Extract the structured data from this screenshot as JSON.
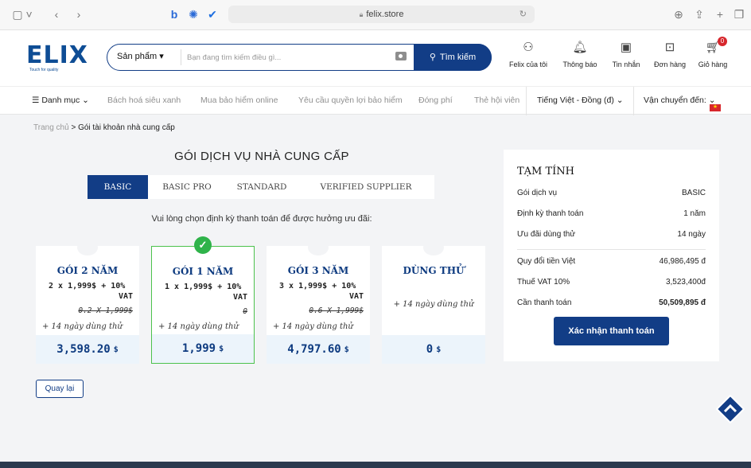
{
  "browser": {
    "url": "felix.store"
  },
  "brand": {
    "name": "ELIX",
    "tagline": "Touch for quality"
  },
  "search": {
    "category": "Sản phẩm ▾",
    "placeholder": "Bạn đang tìm kiếm điều gì...",
    "button": "Tìm kiếm"
  },
  "header_icons": [
    {
      "label": "Felix của tôi"
    },
    {
      "label": "Thông báo"
    },
    {
      "label": "Tin nhắn"
    },
    {
      "label": "Đơn hàng"
    },
    {
      "label": "Giỏ hàng",
      "badge": "0"
    }
  ],
  "nav": {
    "menu": "Danh mục",
    "links": [
      "Bách hoá siêu xanh",
      "Mua bảo hiểm online",
      "Yêu cầu quyền lợi bảo hiểm",
      "Đóng phí",
      "Thẻ hội viên"
    ],
    "language": "Tiếng Việt - Đồng (đ)",
    "shipping": "Vận chuyển đến:"
  },
  "breadcrumb": {
    "home": "Trang chủ",
    "sep": ">",
    "current": "Gói tài khoản nhà cung cấp"
  },
  "main": {
    "title": "GÓI DỊCH VỤ NHÀ CUNG CẤP",
    "tabs": [
      "BASIC",
      "BASIC PRO",
      "STANDARD",
      "VERIFIED SUPPLIER"
    ],
    "hint": "Vui lòng chọn định kỳ thanh toán để được hưởng ưu đãi:",
    "plans": [
      {
        "name": "GÓI 2 NĂM",
        "line1": "2 x 1,999$ + 10%",
        "line2": "VAT",
        "old": "0.2 X 1,999$",
        "trial": "+ 14 ngày dùng thử",
        "price": "3,598.20",
        "unit": "$"
      },
      {
        "name": "GÓI 1 NĂM",
        "line1": "1 x 1,999$ + 10%",
        "line2": "VAT",
        "old": "0",
        "trial": "+ 14 ngày dùng thử",
        "price": "1,999",
        "unit": "$",
        "selected": true
      },
      {
        "name": "GÓI 3 NĂM",
        "line1": "3 x 1,999$ + 10%",
        "line2": "VAT",
        "old": "0.6 X 1,999$",
        "trial": "+ 14 ngày dùng thử",
        "price": "4,797.60",
        "unit": "$"
      },
      {
        "name": "DÙNG THỬ",
        "trial": "+ 14 ngày dùng thử",
        "price": "0",
        "unit": "$"
      }
    ],
    "back": "Quay lại"
  },
  "summary": {
    "title": "TẠM TÍNH",
    "rows": [
      {
        "label": "Gói dịch vụ",
        "value": "BASIC"
      },
      {
        "label": "Định kỳ thanh toán",
        "value": "1 năm"
      },
      {
        "label": "Ưu đãi dùng thử",
        "value": "14 ngày"
      },
      {
        "label": "Quy đổi tiền Việt",
        "value": "46,986,495 đ"
      },
      {
        "label": "Thuế VAT 10%",
        "value": "3,523,400đ"
      },
      {
        "label": "Cần thanh toán",
        "value": "50,509,895 đ"
      }
    ],
    "confirm": "Xác nhận thanh toán"
  }
}
